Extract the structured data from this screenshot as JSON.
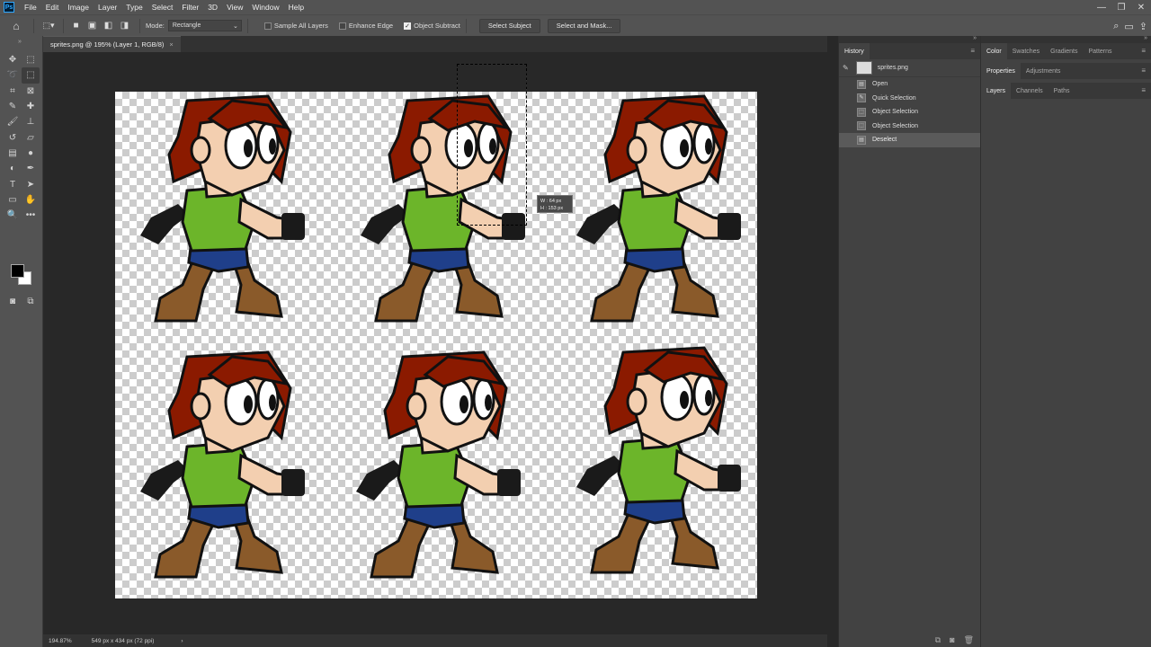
{
  "app": {
    "logo": "Ps",
    "menus": [
      "File",
      "Edit",
      "Image",
      "Layer",
      "Type",
      "Select",
      "Filter",
      "3D",
      "View",
      "Window",
      "Help"
    ]
  },
  "window_controls": {
    "minimize": "—",
    "restore": "❐",
    "close": "✕"
  },
  "options": {
    "mode_label": "Mode:",
    "mode_value": "Rectangle",
    "sample_all_layers": "Sample All Layers",
    "enhance_edge": "Enhance Edge",
    "object_subtract": "Object Subtract",
    "object_subtract_checked": true,
    "select_subject": "Select Subject",
    "select_and_mask": "Select and Mask..."
  },
  "document": {
    "tab_title": "sprites.png @ 195% (Layer 1, RGB/8)",
    "zoom": "194.87%",
    "dimensions": "549 px x 434 px (72 ppi)",
    "selection_tip_w": "W :   64 px",
    "selection_tip_h": "H :  153 px"
  },
  "history": {
    "tab": "History",
    "snapshot": "sprites.png",
    "items": [
      {
        "label": "Open"
      },
      {
        "label": "Quick Selection"
      },
      {
        "label": "Object Selection"
      },
      {
        "label": "Object Selection"
      },
      {
        "label": "Deselect"
      }
    ]
  },
  "right_panels": {
    "group1": [
      "Color",
      "Swatches",
      "Gradients",
      "Patterns"
    ],
    "group2": [
      "Properties",
      "Adjustments"
    ],
    "group3": [
      "Layers",
      "Channels",
      "Paths"
    ]
  },
  "colors": {
    "foreground": "#000000",
    "background": "#ffffff",
    "hair": "#8b1a00",
    "shirt": "#6cb52a",
    "shorts": "#1f3f8a",
    "boots": "#8a5a2a",
    "skin": "#f3cfb0"
  }
}
